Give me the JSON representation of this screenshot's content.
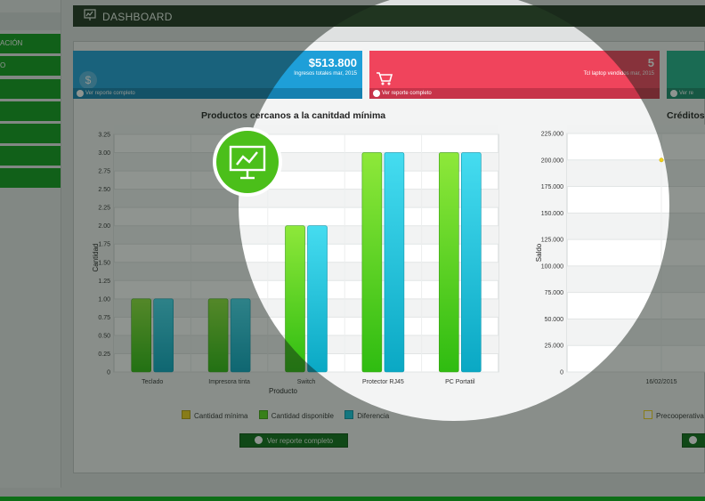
{
  "header": {
    "title": "DASHBOARD"
  },
  "sidebar": {
    "items": [
      "ACIÓN",
      "O",
      "",
      "",
      "",
      "",
      ""
    ]
  },
  "cards": [
    {
      "value": "$513.800",
      "subtitle": "Ingresos totales mar, 2015",
      "link": "Ver reporte completo",
      "color": "#1e9fd8"
    },
    {
      "value": "5",
      "subtitle": "Tcl laptop vendidos mar, 2015",
      "link": "Ver reporte completo",
      "color": "#f0445c"
    },
    {
      "value": "",
      "subtitle": "",
      "link": "Ver re",
      "color": "#1fb08a"
    }
  ],
  "chart1": {
    "title": "Productos cercanos a la canitdad mínima",
    "button": "Ver reporte completo"
  },
  "chart2": {
    "title": "Créditos",
    "button": ""
  },
  "chart_data": [
    {
      "type": "bar",
      "title": "Productos cercanos a la canitdad mínima",
      "xlabel": "Producto",
      "ylabel": "Cantidad",
      "categories": [
        "Teclado",
        "Impresora tinta",
        "Switch",
        "Protector RJ45",
        "PC Portatil"
      ],
      "series": [
        {
          "name": "Cantidad mínima",
          "values": [
            0,
            0,
            0,
            0,
            0
          ],
          "color": "#f2d21b"
        },
        {
          "name": "Cantidad disponible",
          "values": [
            1,
            1,
            2,
            3,
            3
          ],
          "color": "#58d81c"
        },
        {
          "name": "Diferencia",
          "values": [
            1,
            1,
            2,
            3,
            3
          ],
          "color": "#14c7e0"
        }
      ],
      "yticks": [
        "0",
        "0.25",
        "0.50",
        "0.75",
        "1.00",
        "1.25",
        "1.50",
        "1.75",
        "2.00",
        "2.25",
        "2.50",
        "2.75",
        "3.00",
        "3.25"
      ],
      "ylim": [
        0,
        3.25
      ],
      "grid": true,
      "legend": "bottom"
    },
    {
      "type": "scatter",
      "title": "Créditos",
      "ylabel": "Saldo",
      "x": [
        "16/02/2015"
      ],
      "series": [
        {
          "name": "Precooperativa C",
          "values": [
            200000
          ],
          "color": "#f2d21b"
        }
      ],
      "yticks": [
        "0",
        "25.000",
        "50.000",
        "75.000",
        "100.000",
        "125.000",
        "150.000",
        "175.000",
        "200.000",
        "225.000"
      ],
      "ylim": [
        0,
        225000
      ],
      "grid": true,
      "legend": "bottom"
    }
  ]
}
